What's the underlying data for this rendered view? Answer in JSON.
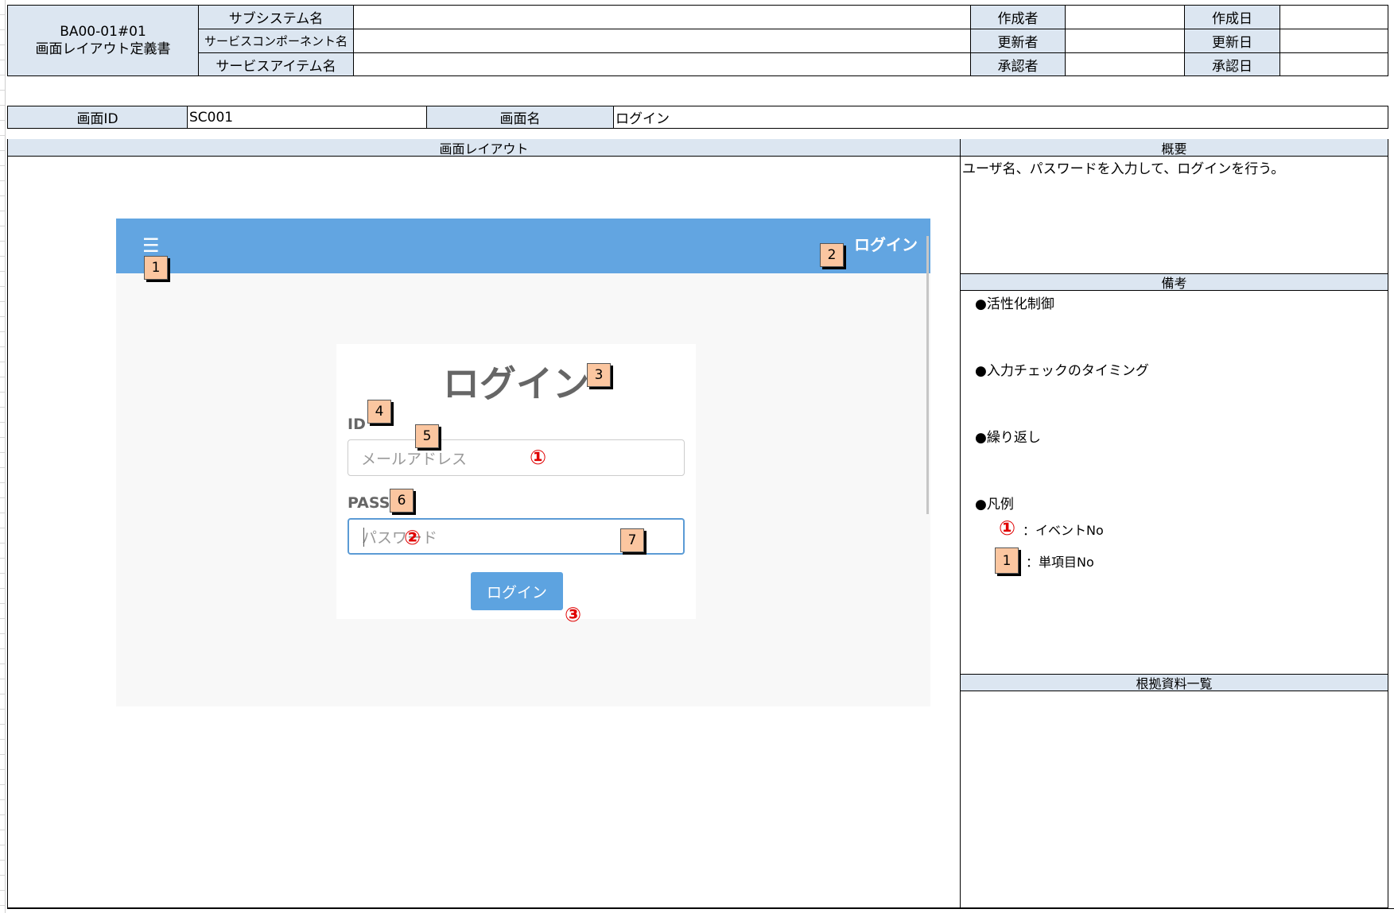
{
  "header": {
    "doc_id": "BA00-01#01",
    "doc_title": "画面レイアウト定義書",
    "rows": [
      {
        "label": "サブシステム名",
        "value": "",
        "role1": "作成者",
        "role1_value": "",
        "date1": "作成日",
        "date1_value": ""
      },
      {
        "label": "サービスコンポーネント名",
        "value": "",
        "role1": "更新者",
        "role1_value": "",
        "date1": "更新日",
        "date1_value": ""
      },
      {
        "label": "サービスアイテム名",
        "value": "",
        "role1": "承認者",
        "role1_value": "",
        "date1": "承認日",
        "date1_value": ""
      }
    ]
  },
  "screen_info": {
    "id_label": "画面ID",
    "id_value": "SC001",
    "name_label": "画面名",
    "name_value": "ログイン"
  },
  "layout_section": {
    "title": "画面レイアウト"
  },
  "summary_section": {
    "title": "概要",
    "text": "ユーザ名、パスワードを入力して、ログインを行う。"
  },
  "remarks_section": {
    "title": "備考",
    "items": [
      "●活性化制御",
      "●入力チェックのタイミング",
      "●繰り返し",
      "●凡例"
    ],
    "legend": {
      "event_symbol": "①",
      "event_text": "：イベントNo",
      "item_symbol": "1",
      "item_text": "：単項目No"
    }
  },
  "references_section": {
    "title": "根拠資料一覧"
  },
  "mockup": {
    "menu_icon": "☰",
    "header_login": "ログイン",
    "title": "ログイン",
    "id_label": "ID",
    "id_placeholder": "メールアドレス",
    "pass_label": "PASS",
    "pass_placeholder": "パスワード",
    "button_label": "ログイン",
    "item_numbers": [
      "1",
      "2",
      "3",
      "4",
      "5",
      "6",
      "7"
    ],
    "event_numbers": [
      "①",
      "②",
      "③"
    ],
    "colors": {
      "header_bar": "#62a5e1",
      "button": "#5da3e0",
      "badge_fill": "#fbc6a0",
      "event_mark": "#e00000",
      "label_cell": "#dce6f1"
    }
  }
}
